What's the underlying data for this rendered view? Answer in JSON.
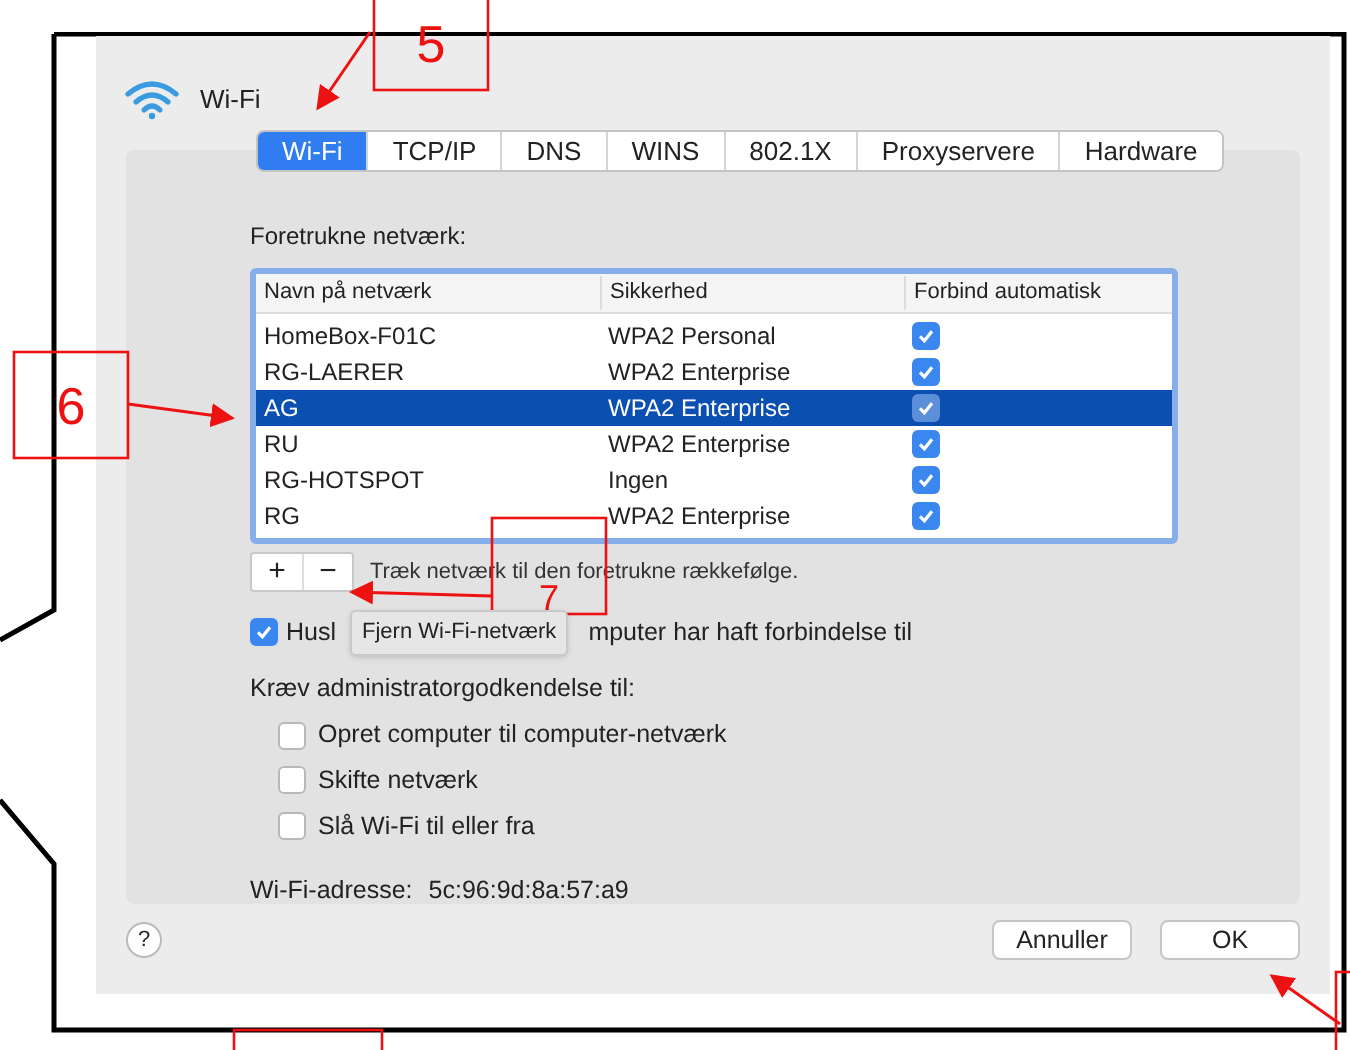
{
  "window": {
    "title": "Wi-Fi"
  },
  "tabs": [
    {
      "label": "Wi-Fi",
      "selected": true
    },
    {
      "label": "TCP/IP",
      "selected": false
    },
    {
      "label": "DNS",
      "selected": false
    },
    {
      "label": "WINS",
      "selected": false
    },
    {
      "label": "802.1X",
      "selected": false
    },
    {
      "label": "Proxyservere",
      "selected": false
    },
    {
      "label": "Hardware",
      "selected": false
    }
  ],
  "networks": {
    "label": "Foretrukne netværk:",
    "columns": [
      "Navn på netværk",
      "Sikkerhed",
      "Forbind automatisk"
    ],
    "rows": [
      {
        "name": "HomeBox-F01C",
        "security": "WPA2 Personal",
        "auto_connect": true,
        "selected": false
      },
      {
        "name": "RG-LAERER",
        "security": "WPA2 Enterprise",
        "auto_connect": true,
        "selected": false
      },
      {
        "name": "AG",
        "security": "WPA2 Enterprise",
        "auto_connect": true,
        "selected": true
      },
      {
        "name": "RU",
        "security": "WPA2 Enterprise",
        "auto_connect": true,
        "selected": false
      },
      {
        "name": "RG-HOTSPOT",
        "security": "Ingen",
        "auto_connect": true,
        "selected": false
      },
      {
        "name": "RG",
        "security": "WPA2 Enterprise",
        "auto_connect": true,
        "selected": false
      }
    ]
  },
  "list_buttons": [
    "+",
    "−"
  ],
  "hint": "Træk netværk til den foretrukne rækkefølge.",
  "remember": {
    "checked": true,
    "label_start": "Husl",
    "label_end": "mputer har haft forbindelse til",
    "tooltip": "Fjern Wi-Fi-netværk"
  },
  "admin": {
    "label": "Kræv administratorgodkendelse til:",
    "options": [
      {
        "label": "Opret computer til computer-netværk",
        "checked": false
      },
      {
        "label": "Skifte netværk",
        "checked": false
      },
      {
        "label": "Slå Wi-Fi til eller fra",
        "checked": false
      }
    ]
  },
  "address": {
    "label": "Wi-Fi-adresse:",
    "value": "5c:96:9d:8a:57:a9"
  },
  "help": "?",
  "buttons": [
    "Annuller",
    "OK"
  ],
  "callouts": [
    {
      "number": "5"
    },
    {
      "number": "6"
    },
    {
      "number": "7"
    }
  ]
}
